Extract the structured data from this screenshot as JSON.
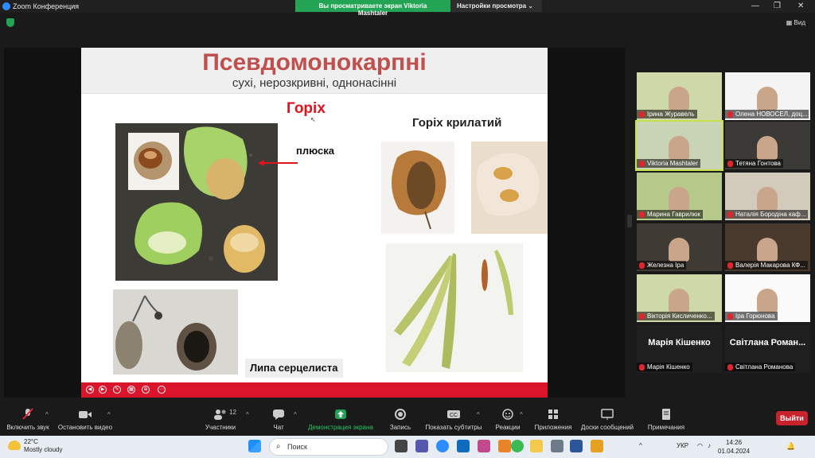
{
  "window": {
    "title": "Zoom Конференция"
  },
  "share_banner": {
    "viewing": "Вы просматриваете экран Viktoria Mashtaler",
    "view_options": "Настройки просмотра"
  },
  "view_button": "Вид",
  "slide": {
    "title": "Псевдомонокарпні",
    "subtitle": "сухі, нерозкривні, однонасінні",
    "heading_nut": "Горіх",
    "heading_winged": "Горіх крилатий",
    "label_cupule": "плюска",
    "label_linden": "Липа серцелиста"
  },
  "participants": [
    {
      "name": "Ірина Журавель",
      "type": "slide"
    },
    {
      "name": "Олена НОВОСЕЛ, доц...",
      "type": "slide"
    },
    {
      "name": "Viktoria Mashtaler",
      "type": "video",
      "active": true
    },
    {
      "name": "Тетяна Гонтова",
      "type": "video"
    },
    {
      "name": "Марина Гаврилюк",
      "type": "video"
    },
    {
      "name": "Наталія Бородіна каф...",
      "type": "video"
    },
    {
      "name": "Железна Іра",
      "type": "video"
    },
    {
      "name": "Валерія Макарова КФ...",
      "type": "video"
    },
    {
      "name": "Вікторія Кисличенко...",
      "type": "video"
    },
    {
      "name": "Іра Горюнова",
      "type": "video"
    },
    {
      "name": "Марія Кішенко",
      "type": "name",
      "big": "Марія Кішенко"
    },
    {
      "name": "Світлана Романова",
      "type": "name",
      "big": "Світлана Роман..."
    }
  ],
  "toolbar": {
    "audio": "Включить звук",
    "video": "Остановить видео",
    "participants": "Участники",
    "participants_count": "12",
    "chat": "Чат",
    "share": "Демонстрация экрана",
    "record": "Запись",
    "subtitles": "Показать субтитры",
    "reactions": "Реакции",
    "apps": "Приложения",
    "whiteboards": "Доски сообщений",
    "notes": "Примечания",
    "leave": "Выйти"
  },
  "taskbar": {
    "temperature": "22°C",
    "weather": "Mostly cloudy",
    "search": "Поиск",
    "lang": "УКР",
    "time": "14:26",
    "date": "01.04.2024"
  },
  "colors": {
    "accent_green": "#23a455",
    "slide_title": "#c0504d",
    "slide_red": "#e0141e",
    "leave": "#c8232c",
    "active_tile": "#c7e04e"
  }
}
